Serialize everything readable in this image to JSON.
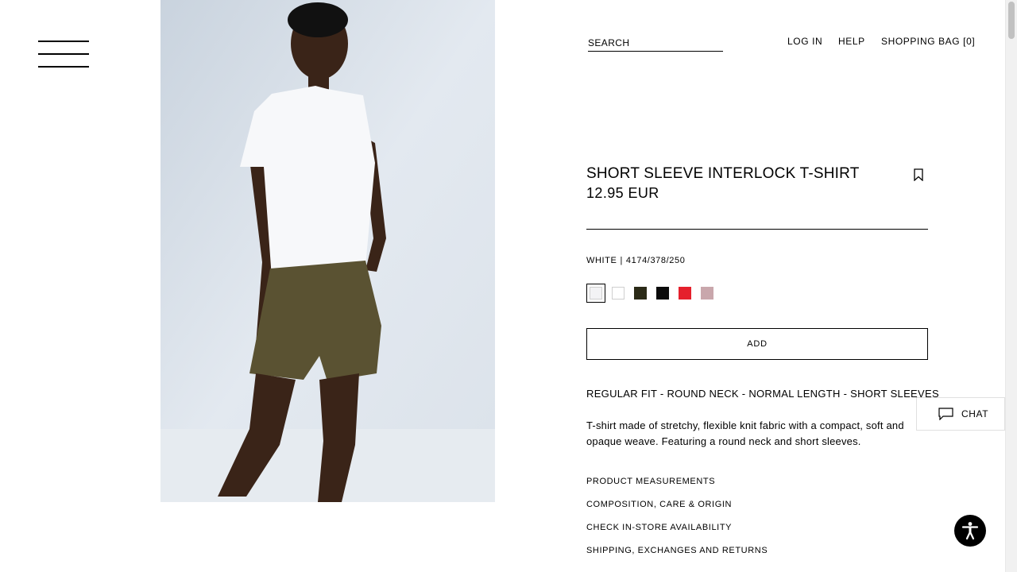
{
  "header": {
    "search_placeholder": "SEARCH",
    "login": "LOG IN",
    "help": "HELP",
    "bag": "SHOPPING BAG [0]"
  },
  "product": {
    "title": "SHORT SLEEVE INTERLOCK T-SHIRT",
    "price": "12.95 EUR",
    "color_name": "WHITE",
    "separator": "|",
    "reference": "4174/378/250",
    "swatches": [
      {
        "name": "off-white",
        "color": "#f3f3f5",
        "selected": true
      },
      {
        "name": "white",
        "color": "#ffffff",
        "selected": false
      },
      {
        "name": "dark-olive",
        "color": "#2b2a17",
        "selected": false
      },
      {
        "name": "black",
        "color": "#0b0b0b",
        "selected": false
      },
      {
        "name": "red",
        "color": "#e5202c",
        "selected": false
      },
      {
        "name": "dusty-pink",
        "color": "#c9a7ac",
        "selected": false
      }
    ],
    "add_label": "ADD",
    "features": "REGULAR FIT - ROUND NECK - NORMAL LENGTH - SHORT SLEEVES",
    "description": "T-shirt made of stretchy, flexible knit fabric with a compact, soft and opaque weave. Featuring a round neck and short sleeves.",
    "links": [
      "PRODUCT MEASUREMENTS",
      "COMPOSITION, CARE & ORIGIN",
      "CHECK IN-STORE AVAILABILITY",
      "SHIPPING, EXCHANGES AND RETURNS"
    ]
  },
  "chat": {
    "label": "CHAT"
  },
  "icons": {
    "menu": "hamburger-menu-icon",
    "bookmark": "bookmark-icon",
    "chat": "chat-bubble-icon",
    "accessibility": "accessibility-icon"
  },
  "colors": {
    "text": "#000000",
    "background": "#ffffff",
    "image_backdrop": "#dfe7ef"
  }
}
